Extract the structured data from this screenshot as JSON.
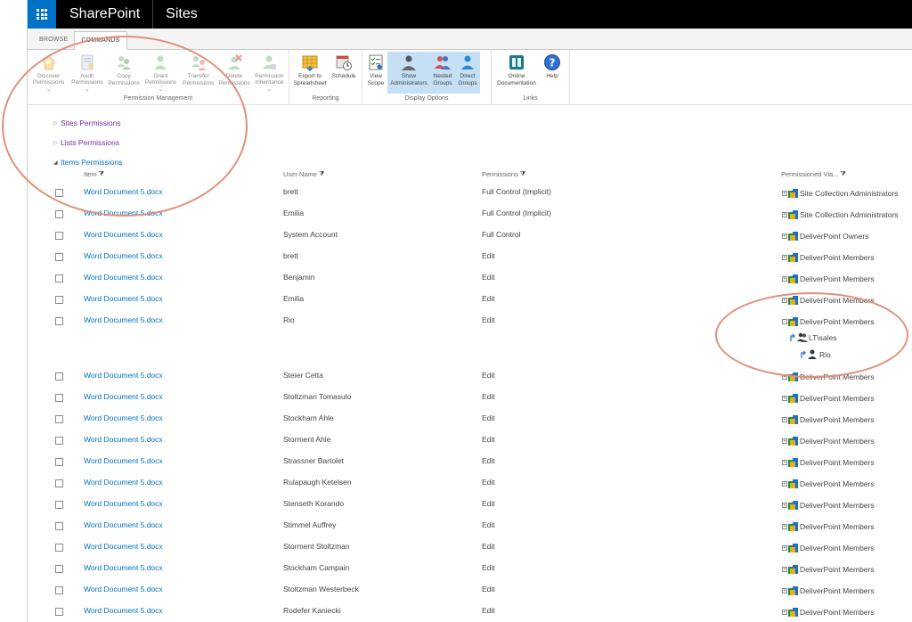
{
  "suite": {
    "brand": "SharePoint",
    "title": "Sites"
  },
  "tabs": [
    {
      "label": "BROWSE",
      "active": false
    },
    {
      "label": "COMMANDS",
      "active": true
    }
  ],
  "ribbon": {
    "groups": [
      {
        "label": "Permission Management",
        "buttons": [
          {
            "label": "Discover\nPermissions ⌄",
            "icon": "discover-permissions-icon"
          },
          {
            "label": "Audit\nPermissions ⌄",
            "icon": "audit-permissions-icon"
          },
          {
            "label": "Copy\nPermissions",
            "icon": "copy-permissions-icon"
          },
          {
            "label": "Grant\nPermissions ⌄",
            "icon": "grant-permissions-icon"
          },
          {
            "label": "Transfer\nPermissions",
            "icon": "transfer-permissions-icon"
          },
          {
            "label": "Delete\nPermissions",
            "icon": "delete-permissions-icon"
          },
          {
            "label": "Permission\nInheritance ⌄",
            "icon": "permission-inheritance-icon"
          }
        ]
      },
      {
        "label": "Reporting",
        "buttons": [
          {
            "label": "Export to\nSpreadsheet",
            "icon": "export-spreadsheet-icon"
          },
          {
            "label": "Schedule",
            "icon": "schedule-icon"
          }
        ]
      },
      {
        "label": "Display Options",
        "buttons": [
          {
            "label": "View\nScope",
            "icon": "view-scope-icon"
          },
          {
            "label": "Show\nAdministrators",
            "icon": "show-administrators-icon",
            "pressed": true
          },
          {
            "label": "Nested\nGroups",
            "icon": "nested-groups-icon",
            "pressed": true
          },
          {
            "label": "Direct\nGroups",
            "icon": "direct-groups-icon",
            "pressed": true
          }
        ]
      },
      {
        "label": "Links",
        "buttons": [
          {
            "label": "Online\nDocumentation",
            "icon": "online-documentation-icon"
          },
          {
            "label": "Help",
            "icon": "help-icon"
          }
        ]
      }
    ]
  },
  "tree": {
    "sites": "Sites Permissions",
    "lists": "Lists Permissions",
    "items": "Items Permissions"
  },
  "columns": {
    "item": "Item",
    "user": "User Name",
    "permissions": "Permissions",
    "via": "Permissioned Via..."
  },
  "rows": [
    {
      "item": "Word Document 5.docx",
      "user": "brett",
      "perm": "Full Control (Implicit)",
      "via": "Site Collection Administrators"
    },
    {
      "item": "Word Document 5.docx",
      "user": "Emilia",
      "perm": "Full Control (Implicit)",
      "via": "Site Collection Administrators"
    },
    {
      "item": "Word Document 5.docx",
      "user": "System Account",
      "perm": "Full Control",
      "via": "DeliverPoint Owners"
    },
    {
      "item": "Word Document 5.docx",
      "user": "brett",
      "perm": "Edit",
      "via": "DeliverPoint Members"
    },
    {
      "item": "Word Document 5.docx",
      "user": "Benjamin",
      "perm": "Edit",
      "via": "DeliverPoint Members"
    },
    {
      "item": "Word Document 5.docx",
      "user": "Emilia",
      "perm": "Edit",
      "via": "DeliverPoint Members"
    },
    {
      "item": "Word Document 5.docx",
      "user": "Rio",
      "perm": "Edit",
      "via": "DeliverPoint Members"
    },
    {
      "item": "Word Document 5.docx",
      "user": "Steier Cetta",
      "perm": "Edit",
      "via": "DeliverPoint Members"
    },
    {
      "item": "Word Document 5.docx",
      "user": "Stoltzman Tomasulo",
      "perm": "Edit",
      "via": "DeliverPoint Members"
    },
    {
      "item": "Word Document 5.docx",
      "user": "Stockham Ahle",
      "perm": "Edit",
      "via": "DeliverPoint Members"
    },
    {
      "item": "Word Document 5.docx",
      "user": "Storment Ahle",
      "perm": "Edit",
      "via": "DeliverPoint Members"
    },
    {
      "item": "Word Document 5.docx",
      "user": "Strassner Bartolet",
      "perm": "Edit",
      "via": "DeliverPoint Members"
    },
    {
      "item": "Word Document 5.docx",
      "user": "Rulapaugh Ketelsen",
      "perm": "Edit",
      "via": "DeliverPoint Members"
    },
    {
      "item": "Word Document 5.docx",
      "user": "Stenseth Korando",
      "perm": "Edit",
      "via": "DeliverPoint Members"
    },
    {
      "item": "Word Document 5.docx",
      "user": "Stimmel Auffrey",
      "perm": "Edit",
      "via": "DeliverPoint Members"
    },
    {
      "item": "Word Document 5.docx",
      "user": "Storment Stoltzman",
      "perm": "Edit",
      "via": "DeliverPoint Members"
    },
    {
      "item": "Word Document 5.docx",
      "user": "Stockham Campain",
      "perm": "Edit",
      "via": "DeliverPoint Members"
    },
    {
      "item": "Word Document 5.docx",
      "user": "Stoltzman Westerbeck",
      "perm": "Edit",
      "via": "DeliverPoint Members"
    },
    {
      "item": "Word Document 5.docx",
      "user": "Rodefer Kaniecki",
      "perm": "Edit",
      "via": "DeliverPoint Members"
    }
  ],
  "expanded": {
    "group": "LT\\sales",
    "user": "Rio"
  },
  "colors": {
    "accent": "#0072c6",
    "annotation": "#e0907a",
    "pressed": "#c5dff5"
  }
}
